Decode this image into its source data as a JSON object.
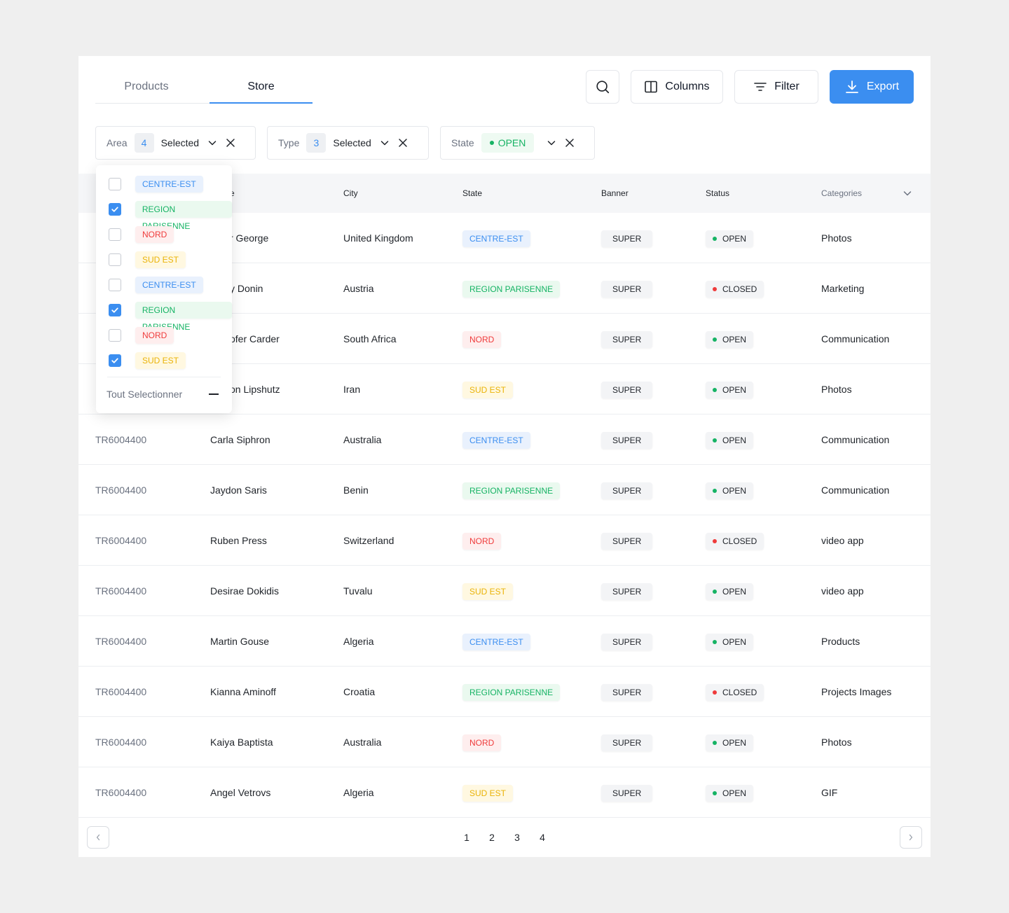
{
  "tabs": [
    {
      "label": "Products",
      "active": false
    },
    {
      "label": "Store",
      "active": true
    }
  ],
  "toolbar": {
    "search_icon": "search-icon",
    "columns_label": "Columns",
    "filter_label": "Filter",
    "export_label": "Export"
  },
  "filters": {
    "area": {
      "label": "Area",
      "count": "4",
      "value": "Selected"
    },
    "type": {
      "label": "Type",
      "count": "3",
      "value": "Selected"
    },
    "state": {
      "label": "State",
      "value": "OPEN"
    }
  },
  "table": {
    "columns": [
      "",
      "",
      "City",
      "State",
      "Banner",
      "Status",
      "Categories"
    ],
    "rows": [
      {
        "code": "",
        "name": "r George",
        "city": "United Kingdom",
        "state": "CENTRE-EST",
        "state_kind": "ce",
        "banner": "SUPER",
        "status": "OPEN",
        "status_kind": "g",
        "category": "Photos"
      },
      {
        "code": "",
        "name": "y Donin",
        "city": "Austria",
        "state": "REGION PARISENNE",
        "state_kind": "rp",
        "banner": "SUPER",
        "status": "CLOSED",
        "status_kind": "r",
        "category": "Marketing"
      },
      {
        "code": "",
        "name": "ofer Carder",
        "city": "South Africa",
        "state": "NORD",
        "state_kind": "no",
        "banner": "SUPER",
        "status": "OPEN",
        "status_kind": "g",
        "category": "Communication"
      },
      {
        "code": "",
        "name": "on Lipshutz",
        "city": "Iran",
        "state": "SUD EST",
        "state_kind": "se",
        "banner": "SUPER",
        "status": "OPEN",
        "status_kind": "g",
        "category": "Photos"
      },
      {
        "code": "TR6004400",
        "name": "Carla Siphron",
        "city": "Australia",
        "state": "CENTRE-EST",
        "state_kind": "ce",
        "banner": "SUPER",
        "status": "OPEN",
        "status_kind": "g",
        "category": "Communication"
      },
      {
        "code": "TR6004400",
        "name": "Jaydon Saris",
        "city": "Benin",
        "state": "REGION PARISENNE",
        "state_kind": "rp",
        "banner": "SUPER",
        "status": "OPEN",
        "status_kind": "g",
        "category": "Communication"
      },
      {
        "code": "TR6004400",
        "name": "Ruben Press",
        "city": "Switzerland",
        "state": "NORD",
        "state_kind": "no",
        "banner": "SUPER",
        "status": "CLOSED",
        "status_kind": "r",
        "category": "video app"
      },
      {
        "code": "TR6004400",
        "name": "Desirae Dokidis",
        "city": "Tuvalu",
        "state": "SUD EST",
        "state_kind": "se",
        "banner": "SUPER",
        "status": "OPEN",
        "status_kind": "g",
        "category": "video app"
      },
      {
        "code": "TR6004400",
        "name": "Martin Gouse",
        "city": "Algeria",
        "state": "CENTRE-EST",
        "state_kind": "ce",
        "banner": "SUPER",
        "status": "OPEN",
        "status_kind": "g",
        "category": "Products"
      },
      {
        "code": "TR6004400",
        "name": "Kianna Aminoff",
        "city": "Croatia",
        "state": "REGION PARISENNE",
        "state_kind": "rp",
        "banner": "SUPER",
        "status": "CLOSED",
        "status_kind": "r",
        "category": "Projects Images"
      },
      {
        "code": "TR6004400",
        "name": "Kaiya Baptista",
        "city": "Australia",
        "state": "NORD",
        "state_kind": "no",
        "banner": "SUPER",
        "status": "OPEN",
        "status_kind": "g",
        "category": "Photos"
      },
      {
        "code": "TR6004400",
        "name": "Angel Vetrovs",
        "city": "Algeria",
        "state": "SUD EST",
        "state_kind": "se",
        "banner": "SUPER",
        "status": "OPEN",
        "status_kind": "g",
        "category": "GIF"
      }
    ]
  },
  "area_dropdown": {
    "options": [
      {
        "label": "CENTRE-EST",
        "kind": "ce",
        "checked": false
      },
      {
        "label": "REGION PARISENNE",
        "kind": "rp",
        "checked": true
      },
      {
        "label": "NORD",
        "kind": "no",
        "checked": false
      },
      {
        "label": "SUD EST",
        "kind": "se",
        "checked": false
      },
      {
        "label": "CENTRE-EST",
        "kind": "ce",
        "checked": false
      },
      {
        "label": "REGION PARISENNE",
        "kind": "rp",
        "checked": true
      },
      {
        "label": "NORD",
        "kind": "no",
        "checked": false
      },
      {
        "label": "SUD EST",
        "kind": "se",
        "checked": true
      }
    ],
    "select_all_label": "Tout Selectionner"
  },
  "pagination": {
    "pages": [
      "1",
      "2",
      "3",
      "4"
    ]
  },
  "colors": {
    "accent": "#3b8ef0",
    "green": "#16b364",
    "red": "#ef3b3b",
    "yellow": "#eab308"
  }
}
